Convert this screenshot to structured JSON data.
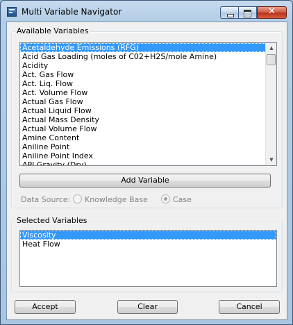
{
  "window": {
    "title": "Multi Variable Navigator",
    "close_glyph": "✕"
  },
  "available": {
    "label": "Available Variables",
    "items": [
      "Acetaldehyde Emissions (RFG)",
      "Acid Gas Loading (moles of C02+H2S/mole Amine)",
      "Acidity",
      "Act. Gas Flow",
      "Act. Liq. Flow",
      "Act. Volume Flow",
      "Actual Gas Flow",
      "Actual Liquid Flow",
      "Actual Mass Density",
      "Actual Volume Flow",
      "Amine Content",
      "Aniline Point",
      "Aniline Point Index",
      "API Gravity (Dry)"
    ],
    "selected_index": 0,
    "add_button": "Add Variable"
  },
  "data_source": {
    "label": "Data Source:",
    "options": [
      "Knowledge Base",
      "Case"
    ],
    "selected": "Case"
  },
  "selected_vars": {
    "label": "Selected Variables",
    "items": [
      "Viscosity",
      "Heat Flow"
    ],
    "selected_index": 0
  },
  "buttons": {
    "accept": "Accept",
    "clear": "Clear",
    "cancel": "Cancel"
  }
}
